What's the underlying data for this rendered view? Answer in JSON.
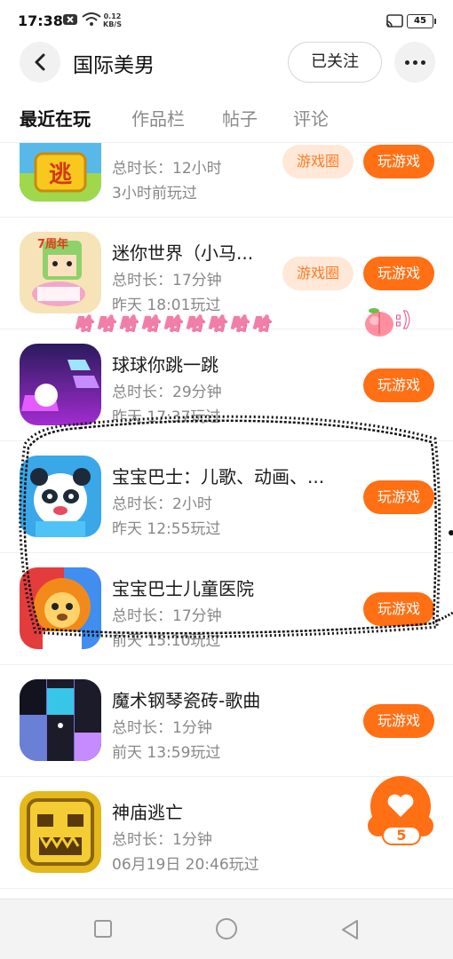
{
  "status_bar": {
    "time": "17:38",
    "net_speed_value": "0.12",
    "net_speed_unit": "KB/S",
    "battery": "45"
  },
  "header": {
    "title": "国际美男",
    "follow_label": "已关注"
  },
  "tabs": [
    {
      "label": "最近在玩",
      "active": true
    },
    {
      "label": "作品栏",
      "active": false
    },
    {
      "label": "帖子",
      "active": false
    },
    {
      "label": "评论",
      "active": false
    }
  ],
  "games": [
    {
      "name": "",
      "duration": "总时长：12小时",
      "last_played": "3小时前玩过",
      "has_circle": true,
      "icon": "escape-game-icon"
    },
    {
      "name": "迷你世界（小马...",
      "duration": "总时长：17分钟",
      "last_played": "昨天 18:01玩过",
      "has_circle": true,
      "icon": "mini-world-icon",
      "badge": "7周年"
    },
    {
      "name": "球球你跳一跳",
      "duration": "总时长：29分钟",
      "last_played": "昨天 17:37玩过",
      "has_circle": false,
      "icon": "ball-jump-icon"
    },
    {
      "name": "宝宝巴士：儿歌、动画、...",
      "duration": "总时长：2小时",
      "last_played": "昨天 12:55玩过",
      "has_circle": false,
      "icon": "panda-icon"
    },
    {
      "name": "宝宝巴士儿童医院",
      "duration": "总时长：17分钟",
      "last_played": "前天 15:10玩过",
      "has_circle": false,
      "icon": "lion-doctor-icon"
    },
    {
      "name": "魔术钢琴瓷砖-歌曲",
      "duration": "总时长：1分钟",
      "last_played": "前天 13:59玩过",
      "has_circle": false,
      "icon": "piano-tiles-icon"
    },
    {
      "name": "神庙逃亡",
      "duration": "总时长：1分钟",
      "last_played": "06月19日 20:46玩过",
      "has_circle": false,
      "icon": "temple-run-icon"
    }
  ],
  "buttons": {
    "play": "玩游戏",
    "circle": "游戏圈"
  },
  "overlay": {
    "haha": "哈哈哈哈哈哈哈哈哈",
    "smiley": ":)",
    "icon_escape_text": "逃"
  },
  "like": {
    "count": "5"
  },
  "colors": {
    "accent": "#ff6f14",
    "circle_bg": "#ffe8d8",
    "meta_text": "#888888"
  }
}
